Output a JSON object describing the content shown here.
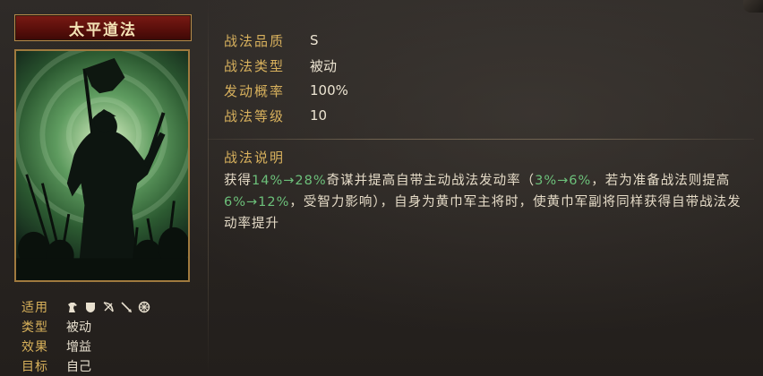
{
  "skill": {
    "name": "太平道法"
  },
  "attributes": [
    {
      "label": "适用",
      "value": ""
    },
    {
      "label": "类型",
      "value": "被动"
    },
    {
      "label": "效果",
      "value": "增益"
    },
    {
      "label": "目标",
      "value": "自己"
    }
  ],
  "unit_icons": [
    "cavalry-icon",
    "shield-icon",
    "bow-icon",
    "spear-icon",
    "wheel-icon"
  ],
  "stats": [
    {
      "label": "战法品质",
      "value": "S"
    },
    {
      "label": "战法类型",
      "value": "被动"
    },
    {
      "label": "发动概率",
      "value": "100%"
    },
    {
      "label": "战法等级",
      "value": "10"
    }
  ],
  "description": {
    "title": "战法说明",
    "segments": [
      {
        "text": "获得",
        "highlight": false
      },
      {
        "text": "14%→28%",
        "highlight": true
      },
      {
        "text": "奇谋并提高自带主动战法发动率（",
        "highlight": false
      },
      {
        "text": "3%→6%",
        "highlight": true
      },
      {
        "text": "，若为准备战法则提高",
        "highlight": false
      },
      {
        "text": "6%→12%",
        "highlight": true
      },
      {
        "text": "，受智力影响），自身为黄巾军主将时，使黄巾军副将同样获得自带战法发动率提升",
        "highlight": false
      }
    ]
  },
  "colors": {
    "label_gold": "#d8b15d",
    "highlight_green": "#6cc07a",
    "banner_red": "#6a140f"
  }
}
